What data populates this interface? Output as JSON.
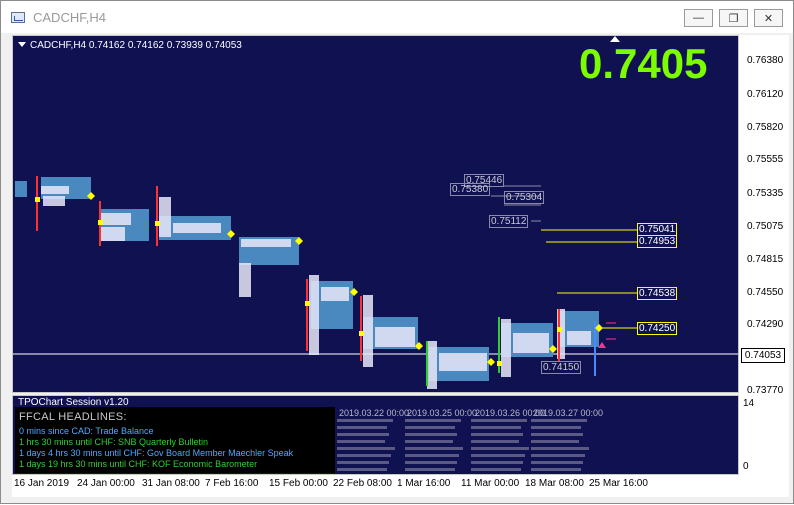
{
  "window": {
    "title": "CADCHF,H4"
  },
  "chart": {
    "header": "CADCHF,H4  0.74162 0.74162 0.73939 0.74053",
    "big_price": "0.7405",
    "current_price_label": "0.74053",
    "level_labels": [
      "0.75446",
      "0.75380",
      "0.75304",
      "0.75112",
      "0.75041",
      "0.74953",
      "0.74538",
      "0.74250",
      "0.74150"
    ]
  },
  "price_axis": {
    "ticks": [
      "0.76380",
      "0.76120",
      "0.75820",
      "0.75555",
      "0.75335",
      "0.75075",
      "0.74815",
      "0.74550",
      "0.74290",
      "0.73770"
    ]
  },
  "time_axis": {
    "ticks": [
      "16 Jan 2019",
      "24 Jan 00:00",
      "31 Jan 08:00",
      "7 Feb 16:00",
      "15 Feb 00:00",
      "22 Feb 08:00",
      "1 Mar 16:00",
      "11 Mar 00:00",
      "18 Mar 08:00",
      "25 Mar 16:00"
    ]
  },
  "subwindow": {
    "title": "TPOChart Session v1.20",
    "axis_top": "14",
    "axis_bottom": "0"
  },
  "headlines": {
    "title": "FFCAL HEADLINES:",
    "items": [
      {
        "text": "0 mins since CAD: Trade Balance",
        "color": "#4fa8ff"
      },
      {
        "text": "1 hrs 30 mins until CHF: SNB Quarterly Bulletin",
        "color": "#32cd32"
      },
      {
        "text": "1 days 4 hrs 30 mins until CHF: Gov Board Member Maechler Speak",
        "color": "#4fa8ff"
      },
      {
        "text": "1 days 19 hrs 30 mins until CHF: KOF Economic Barometer",
        "color": "#32cd32"
      }
    ]
  },
  "stats": {
    "dates": [
      "2019.03.22 00:00",
      "2019.03.25 00:00",
      "2019.03.26 00:00",
      "2019.03.27 00:00"
    ]
  }
}
